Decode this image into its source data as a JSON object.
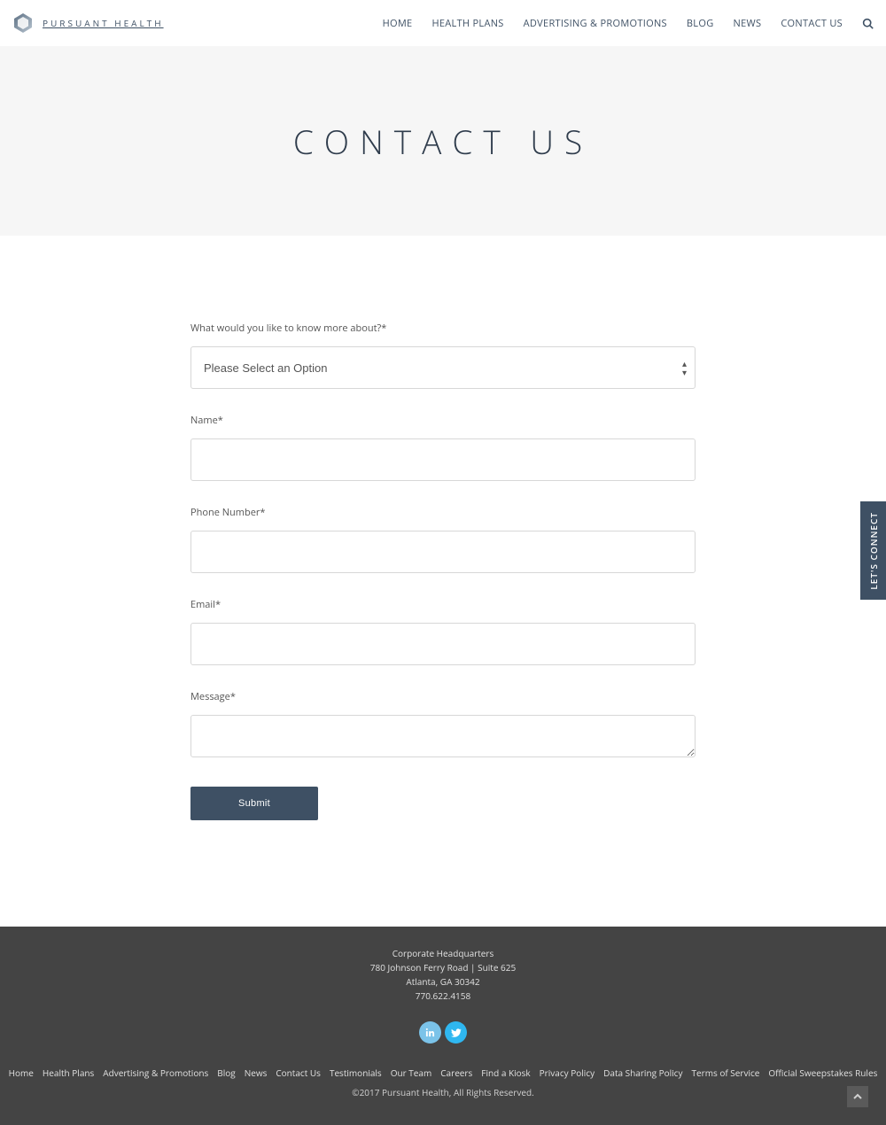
{
  "brand": {
    "wordmark": "PURSUANT HEALTH"
  },
  "nav": {
    "items": [
      {
        "label": "HOME"
      },
      {
        "label": "HEALTH PLANS"
      },
      {
        "label": "ADVERTISING & PROMOTIONS"
      },
      {
        "label": "BLOG"
      },
      {
        "label": "NEWS"
      },
      {
        "label": "CONTACT US"
      }
    ]
  },
  "hero": {
    "title": "CONTACT US"
  },
  "form": {
    "topic_label": "What would you like to know more about?*",
    "topic_selected": "Please Select an Option",
    "name_label": "Name*",
    "phone_label": "Phone Number*",
    "email_label": "Email*",
    "message_label": "Message*",
    "submit_label": "Submit"
  },
  "side_tab": {
    "label": "LET'S CONNECT"
  },
  "footer": {
    "hq_title": "Corporate Headquarters",
    "hq_addr1": "780 Johnson Ferry Road | Suite 625",
    "hq_addr2": "Atlanta, GA 30342",
    "hq_phone": "770.622.4158",
    "links": [
      {
        "label": "Home"
      },
      {
        "label": "Health Plans"
      },
      {
        "label": "Advertising & Promotions"
      },
      {
        "label": "Blog"
      },
      {
        "label": "News"
      },
      {
        "label": "Contact Us"
      },
      {
        "label": "Testimonials"
      },
      {
        "label": "Our Team"
      },
      {
        "label": "Careers"
      },
      {
        "label": "Find a Kiosk"
      },
      {
        "label": "Privacy Policy"
      },
      {
        "label": "Data Sharing Policy"
      },
      {
        "label": "Terms of Service"
      },
      {
        "label": "Official Sweepstakes Rules"
      }
    ],
    "copyright": "©2017 Pursuant Health, All Rights Reserved."
  }
}
